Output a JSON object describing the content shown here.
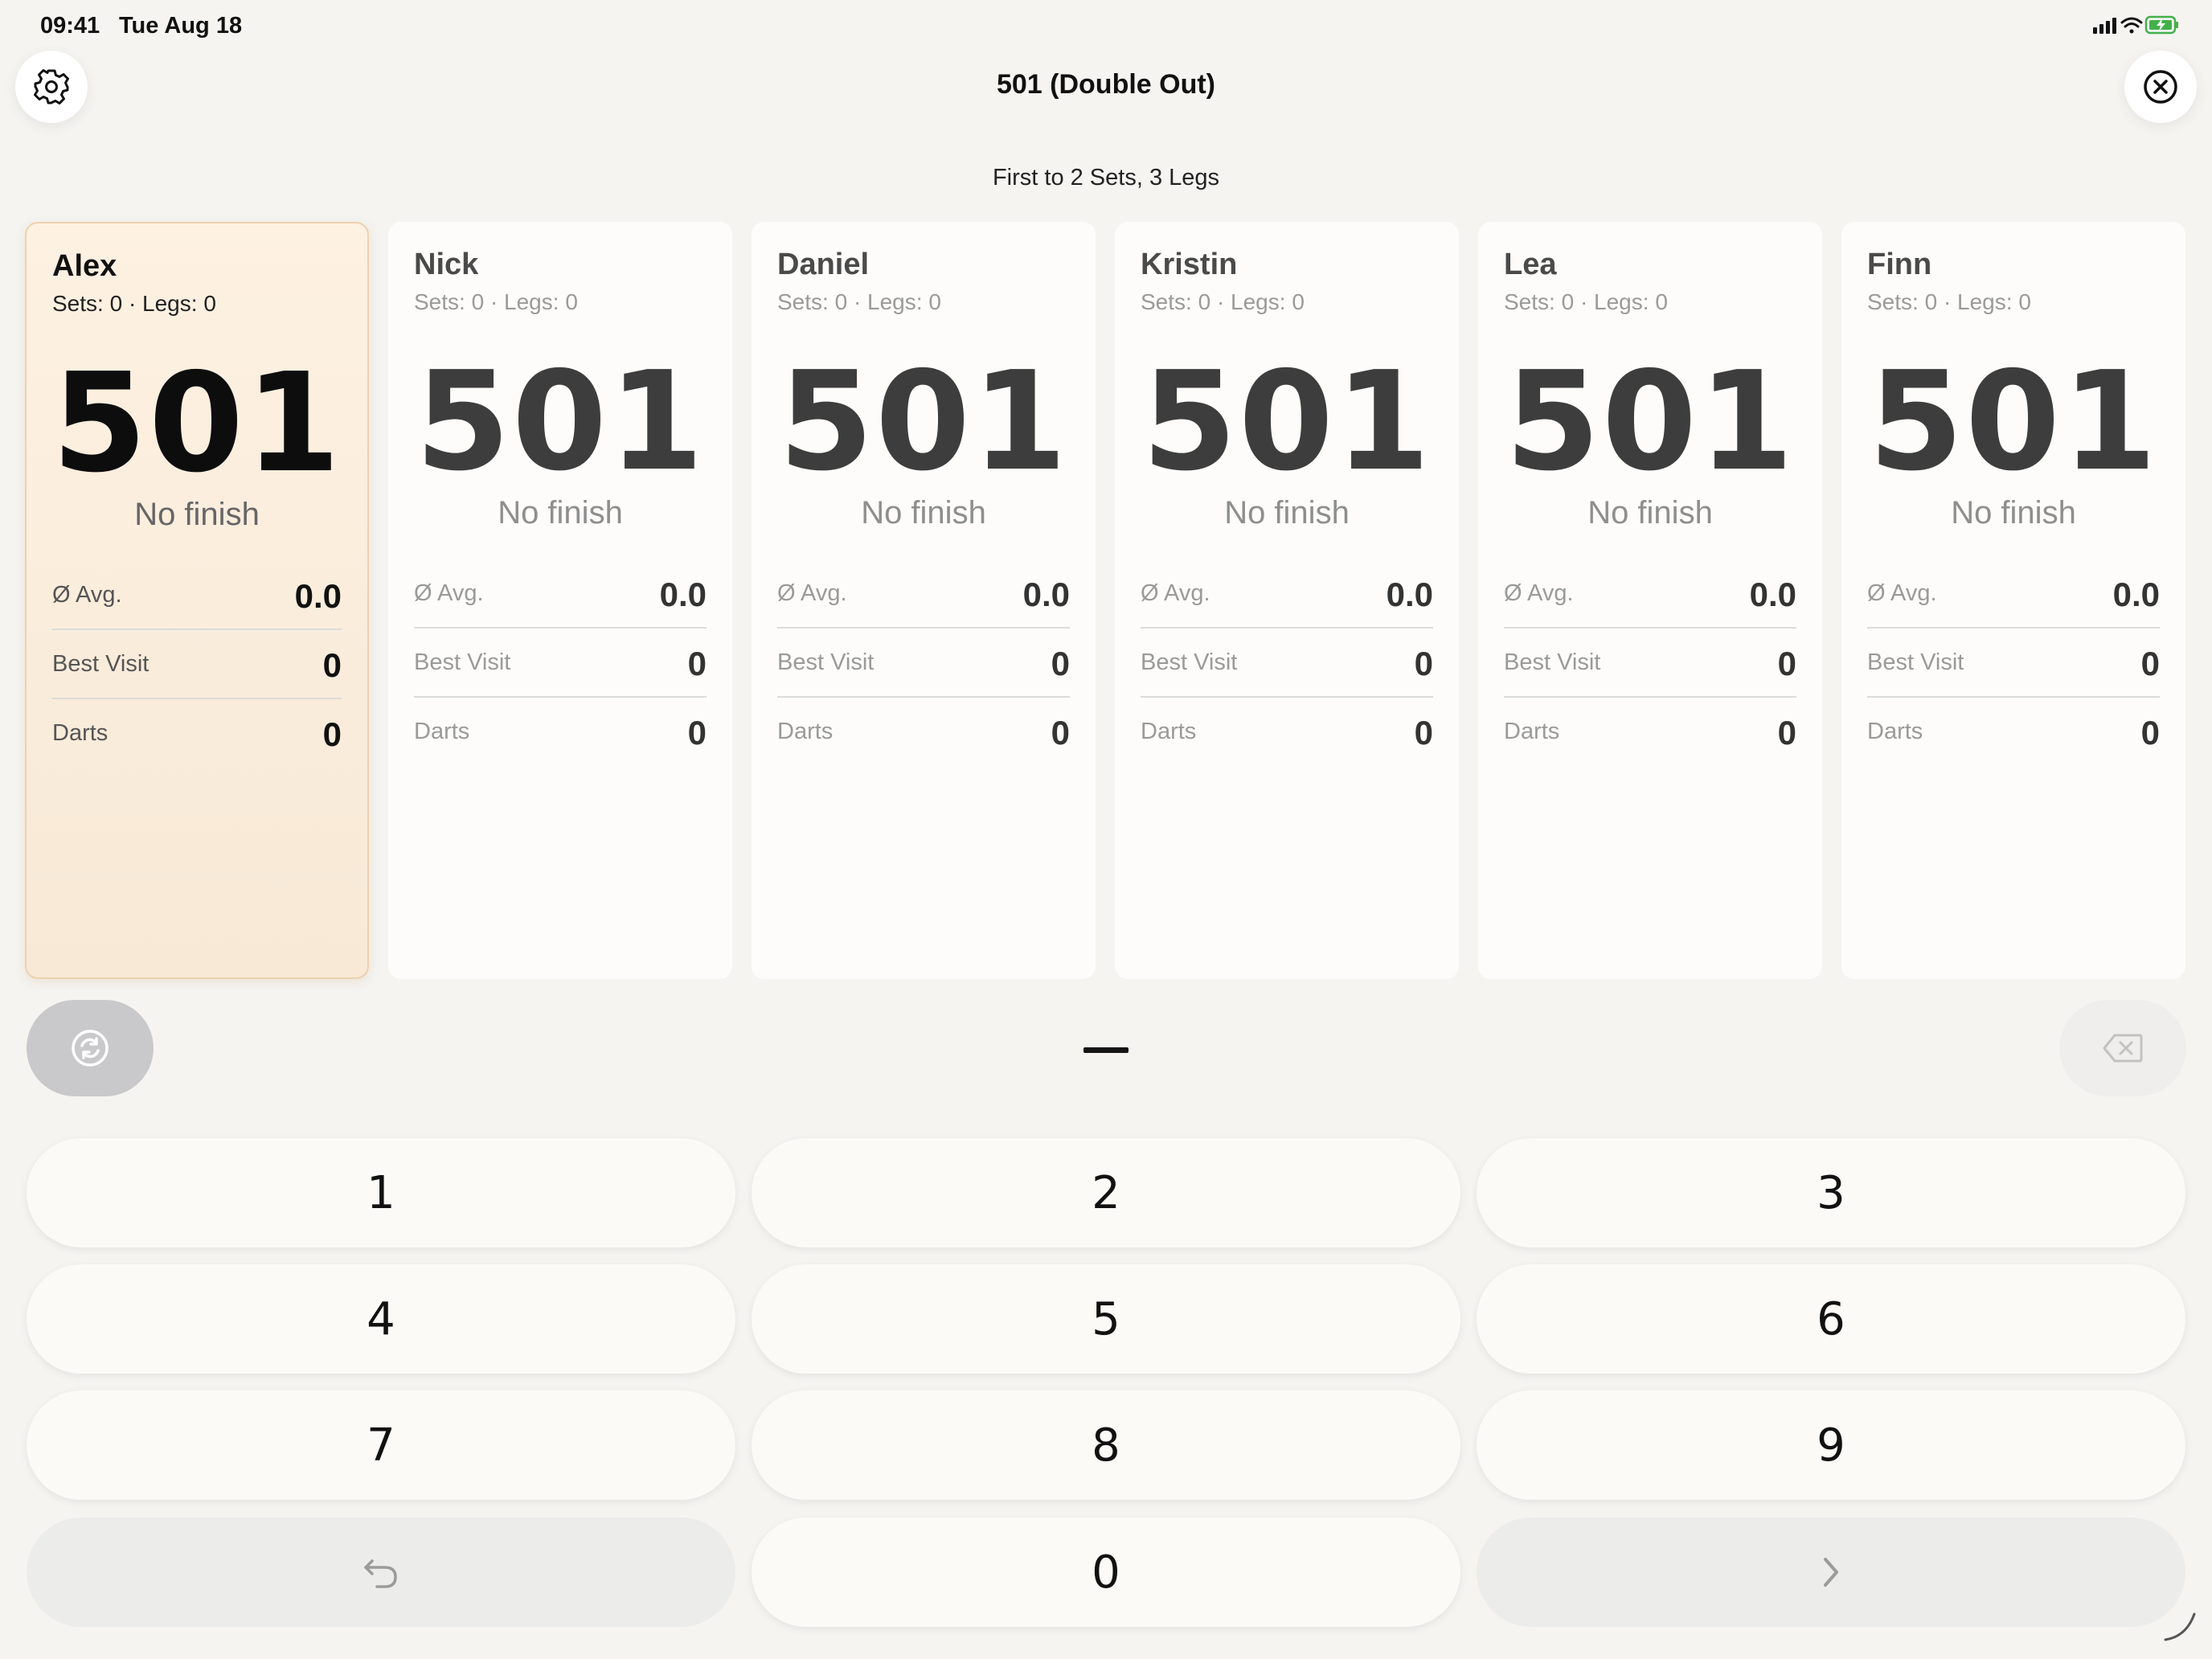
{
  "status_bar": {
    "time": "09:41",
    "date": "Tue Aug 18"
  },
  "header": {
    "title": "501 (Double Out)",
    "subtitle": "First to 2 Sets, 3 Legs"
  },
  "players": [
    {
      "name": "Alex",
      "sets_legs": "Sets: 0 · Legs: 0",
      "score": "501",
      "finish": "No finish",
      "avg_label": "Ø Avg.",
      "avg": "0.0",
      "best_label": "Best Visit",
      "best": "0",
      "darts_label": "Darts",
      "darts": "0",
      "active": true
    },
    {
      "name": "Nick",
      "sets_legs": "Sets: 0 · Legs: 0",
      "score": "501",
      "finish": "No finish",
      "avg_label": "Ø Avg.",
      "avg": "0.0",
      "best_label": "Best Visit",
      "best": "0",
      "darts_label": "Darts",
      "darts": "0",
      "active": false
    },
    {
      "name": "Daniel",
      "sets_legs": "Sets: 0 · Legs: 0",
      "score": "501",
      "finish": "No finish",
      "avg_label": "Ø Avg.",
      "avg": "0.0",
      "best_label": "Best Visit",
      "best": "0",
      "darts_label": "Darts",
      "darts": "0",
      "active": false
    },
    {
      "name": "Kristin",
      "sets_legs": "Sets: 0 · Legs: 0",
      "score": "501",
      "finish": "No finish",
      "avg_label": "Ø Avg.",
      "avg": "0.0",
      "best_label": "Best Visit",
      "best": "0",
      "darts_label": "Darts",
      "darts": "0",
      "active": false
    },
    {
      "name": "Lea",
      "sets_legs": "Sets: 0 · Legs: 0",
      "score": "501",
      "finish": "No finish",
      "avg_label": "Ø Avg.",
      "avg": "0.0",
      "best_label": "Best Visit",
      "best": "0",
      "darts_label": "Darts",
      "darts": "0",
      "active": false
    },
    {
      "name": "Finn",
      "sets_legs": "Sets: 0 · Legs: 0",
      "score": "501",
      "finish": "No finish",
      "avg_label": "Ø Avg.",
      "avg": "0.0",
      "best_label": "Best Visit",
      "best": "0",
      "darts_label": "Darts",
      "darts": "0",
      "active": false
    }
  ],
  "keypad": {
    "keys": [
      "1",
      "2",
      "3",
      "4",
      "5",
      "6",
      "7",
      "8",
      "9",
      "0"
    ],
    "undo_icon": "undo-arrow-icon",
    "next_icon": "chevron-right-icon"
  },
  "icons": {
    "settings": "gear-icon",
    "close": "close-circle-icon",
    "switch": "refresh-circle-icon",
    "backspace": "backspace-icon"
  },
  "colors": {
    "active_card": "#fdf1e2",
    "active_border": "#ecd2b0",
    "background": "#f5f4f1"
  }
}
